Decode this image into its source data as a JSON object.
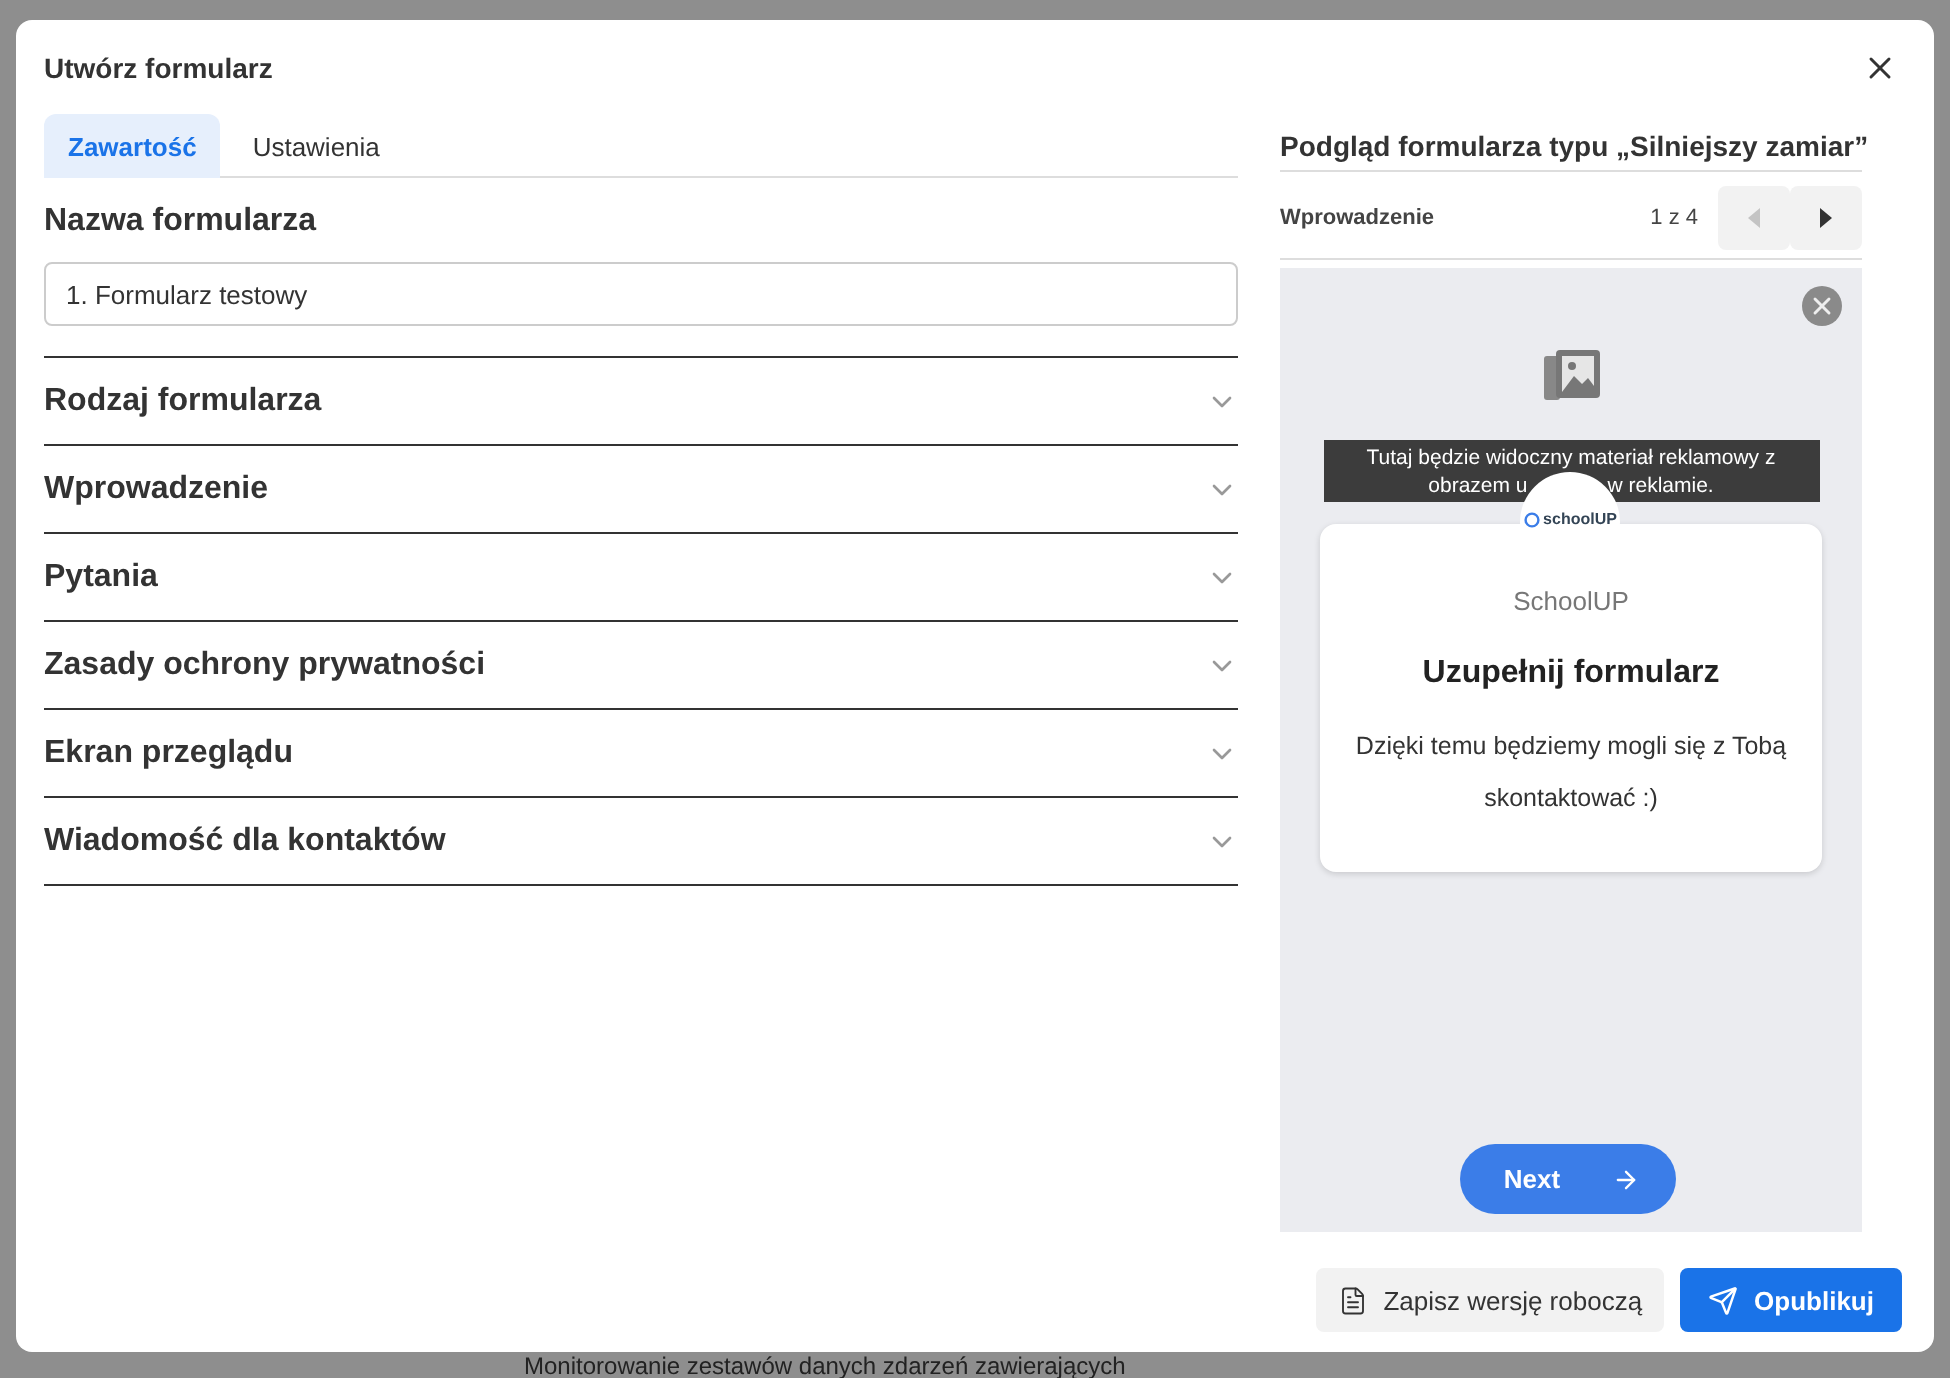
{
  "background": {
    "text": "Monitorowanie zestawów danych zdarzeń zawierających"
  },
  "dialog": {
    "title": "Utwórz formularz",
    "tabs": [
      {
        "label": "Zawartość",
        "selected": true
      },
      {
        "label": "Ustawienia",
        "selected": false
      }
    ],
    "name_label": "Nazwa formularza",
    "name_field": {
      "value": "1. Formularz testowy"
    },
    "sections": [
      {
        "label": "Rodzaj formularza",
        "expanded": false
      },
      {
        "label": "Wprowadzenie",
        "expanded": false
      },
      {
        "label": "Pytania",
        "expanded": false
      },
      {
        "label": "Zasady ochrony prywatności",
        "expanded": false
      },
      {
        "label": "Ekran przeglądu",
        "expanded": false
      },
      {
        "label": "Wiadomość dla kontaktów",
        "expanded": false
      }
    ],
    "preview": {
      "title": "Podgląd formularza typu „Silniejszy zamiar”",
      "step": "Wprowadzenie",
      "counter": "1 z 4",
      "nav": [
        {
          "kind": "prev",
          "disabled": true
        },
        {
          "kind": "next",
          "disabled": false
        }
      ],
      "banner": {
        "line_1": "Tutaj będzie widoczny materiał reklamowy z",
        "line_2_start": "obrazem u",
        "line_2_end": "w reklamie."
      },
      "logo_text": "schoolUP",
      "brand": "SchoolUP",
      "heading": "Uzupełnij formularz",
      "body": "Dzięki temu będziemy mogli się z Tobą skontaktować :)",
      "next_button": "Next"
    },
    "buttons": [
      {
        "kind": "draft",
        "label": "Zapisz wersję roboczą"
      },
      {
        "kind": "publish",
        "label": "Opublikuj"
      }
    ]
  }
}
